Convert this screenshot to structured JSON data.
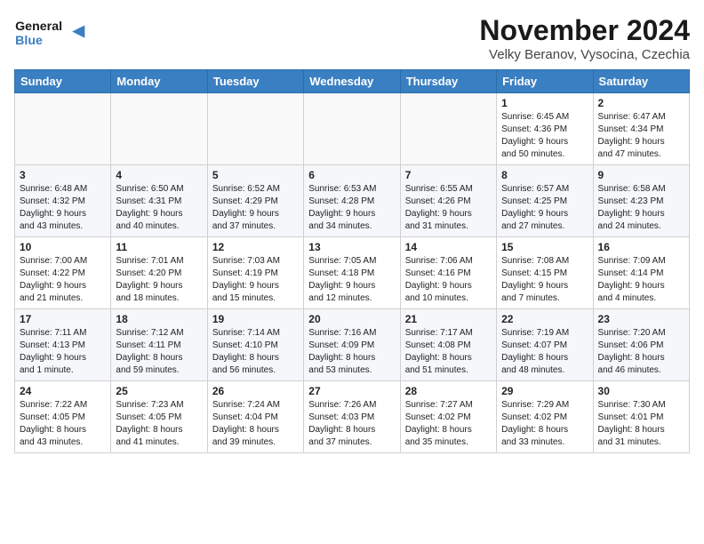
{
  "header": {
    "logo_line1": "General",
    "logo_line2": "Blue",
    "month": "November 2024",
    "location": "Velky Beranov, Vysocina, Czechia"
  },
  "days_of_week": [
    "Sunday",
    "Monday",
    "Tuesday",
    "Wednesday",
    "Thursday",
    "Friday",
    "Saturday"
  ],
  "weeks": [
    [
      {
        "day": "",
        "info": ""
      },
      {
        "day": "",
        "info": ""
      },
      {
        "day": "",
        "info": ""
      },
      {
        "day": "",
        "info": ""
      },
      {
        "day": "",
        "info": ""
      },
      {
        "day": "1",
        "info": "Sunrise: 6:45 AM\nSunset: 4:36 PM\nDaylight: 9 hours\nand 50 minutes."
      },
      {
        "day": "2",
        "info": "Sunrise: 6:47 AM\nSunset: 4:34 PM\nDaylight: 9 hours\nand 47 minutes."
      }
    ],
    [
      {
        "day": "3",
        "info": "Sunrise: 6:48 AM\nSunset: 4:32 PM\nDaylight: 9 hours\nand 43 minutes."
      },
      {
        "day": "4",
        "info": "Sunrise: 6:50 AM\nSunset: 4:31 PM\nDaylight: 9 hours\nand 40 minutes."
      },
      {
        "day": "5",
        "info": "Sunrise: 6:52 AM\nSunset: 4:29 PM\nDaylight: 9 hours\nand 37 minutes."
      },
      {
        "day": "6",
        "info": "Sunrise: 6:53 AM\nSunset: 4:28 PM\nDaylight: 9 hours\nand 34 minutes."
      },
      {
        "day": "7",
        "info": "Sunrise: 6:55 AM\nSunset: 4:26 PM\nDaylight: 9 hours\nand 31 minutes."
      },
      {
        "day": "8",
        "info": "Sunrise: 6:57 AM\nSunset: 4:25 PM\nDaylight: 9 hours\nand 27 minutes."
      },
      {
        "day": "9",
        "info": "Sunrise: 6:58 AM\nSunset: 4:23 PM\nDaylight: 9 hours\nand 24 minutes."
      }
    ],
    [
      {
        "day": "10",
        "info": "Sunrise: 7:00 AM\nSunset: 4:22 PM\nDaylight: 9 hours\nand 21 minutes."
      },
      {
        "day": "11",
        "info": "Sunrise: 7:01 AM\nSunset: 4:20 PM\nDaylight: 9 hours\nand 18 minutes."
      },
      {
        "day": "12",
        "info": "Sunrise: 7:03 AM\nSunset: 4:19 PM\nDaylight: 9 hours\nand 15 minutes."
      },
      {
        "day": "13",
        "info": "Sunrise: 7:05 AM\nSunset: 4:18 PM\nDaylight: 9 hours\nand 12 minutes."
      },
      {
        "day": "14",
        "info": "Sunrise: 7:06 AM\nSunset: 4:16 PM\nDaylight: 9 hours\nand 10 minutes."
      },
      {
        "day": "15",
        "info": "Sunrise: 7:08 AM\nSunset: 4:15 PM\nDaylight: 9 hours\nand 7 minutes."
      },
      {
        "day": "16",
        "info": "Sunrise: 7:09 AM\nSunset: 4:14 PM\nDaylight: 9 hours\nand 4 minutes."
      }
    ],
    [
      {
        "day": "17",
        "info": "Sunrise: 7:11 AM\nSunset: 4:13 PM\nDaylight: 9 hours\nand 1 minute."
      },
      {
        "day": "18",
        "info": "Sunrise: 7:12 AM\nSunset: 4:11 PM\nDaylight: 8 hours\nand 59 minutes."
      },
      {
        "day": "19",
        "info": "Sunrise: 7:14 AM\nSunset: 4:10 PM\nDaylight: 8 hours\nand 56 minutes."
      },
      {
        "day": "20",
        "info": "Sunrise: 7:16 AM\nSunset: 4:09 PM\nDaylight: 8 hours\nand 53 minutes."
      },
      {
        "day": "21",
        "info": "Sunrise: 7:17 AM\nSunset: 4:08 PM\nDaylight: 8 hours\nand 51 minutes."
      },
      {
        "day": "22",
        "info": "Sunrise: 7:19 AM\nSunset: 4:07 PM\nDaylight: 8 hours\nand 48 minutes."
      },
      {
        "day": "23",
        "info": "Sunrise: 7:20 AM\nSunset: 4:06 PM\nDaylight: 8 hours\nand 46 minutes."
      }
    ],
    [
      {
        "day": "24",
        "info": "Sunrise: 7:22 AM\nSunset: 4:05 PM\nDaylight: 8 hours\nand 43 minutes."
      },
      {
        "day": "25",
        "info": "Sunrise: 7:23 AM\nSunset: 4:05 PM\nDaylight: 8 hours\nand 41 minutes."
      },
      {
        "day": "26",
        "info": "Sunrise: 7:24 AM\nSunset: 4:04 PM\nDaylight: 8 hours\nand 39 minutes."
      },
      {
        "day": "27",
        "info": "Sunrise: 7:26 AM\nSunset: 4:03 PM\nDaylight: 8 hours\nand 37 minutes."
      },
      {
        "day": "28",
        "info": "Sunrise: 7:27 AM\nSunset: 4:02 PM\nDaylight: 8 hours\nand 35 minutes."
      },
      {
        "day": "29",
        "info": "Sunrise: 7:29 AM\nSunset: 4:02 PM\nDaylight: 8 hours\nand 33 minutes."
      },
      {
        "day": "30",
        "info": "Sunrise: 7:30 AM\nSunset: 4:01 PM\nDaylight: 8 hours\nand 31 minutes."
      }
    ]
  ]
}
